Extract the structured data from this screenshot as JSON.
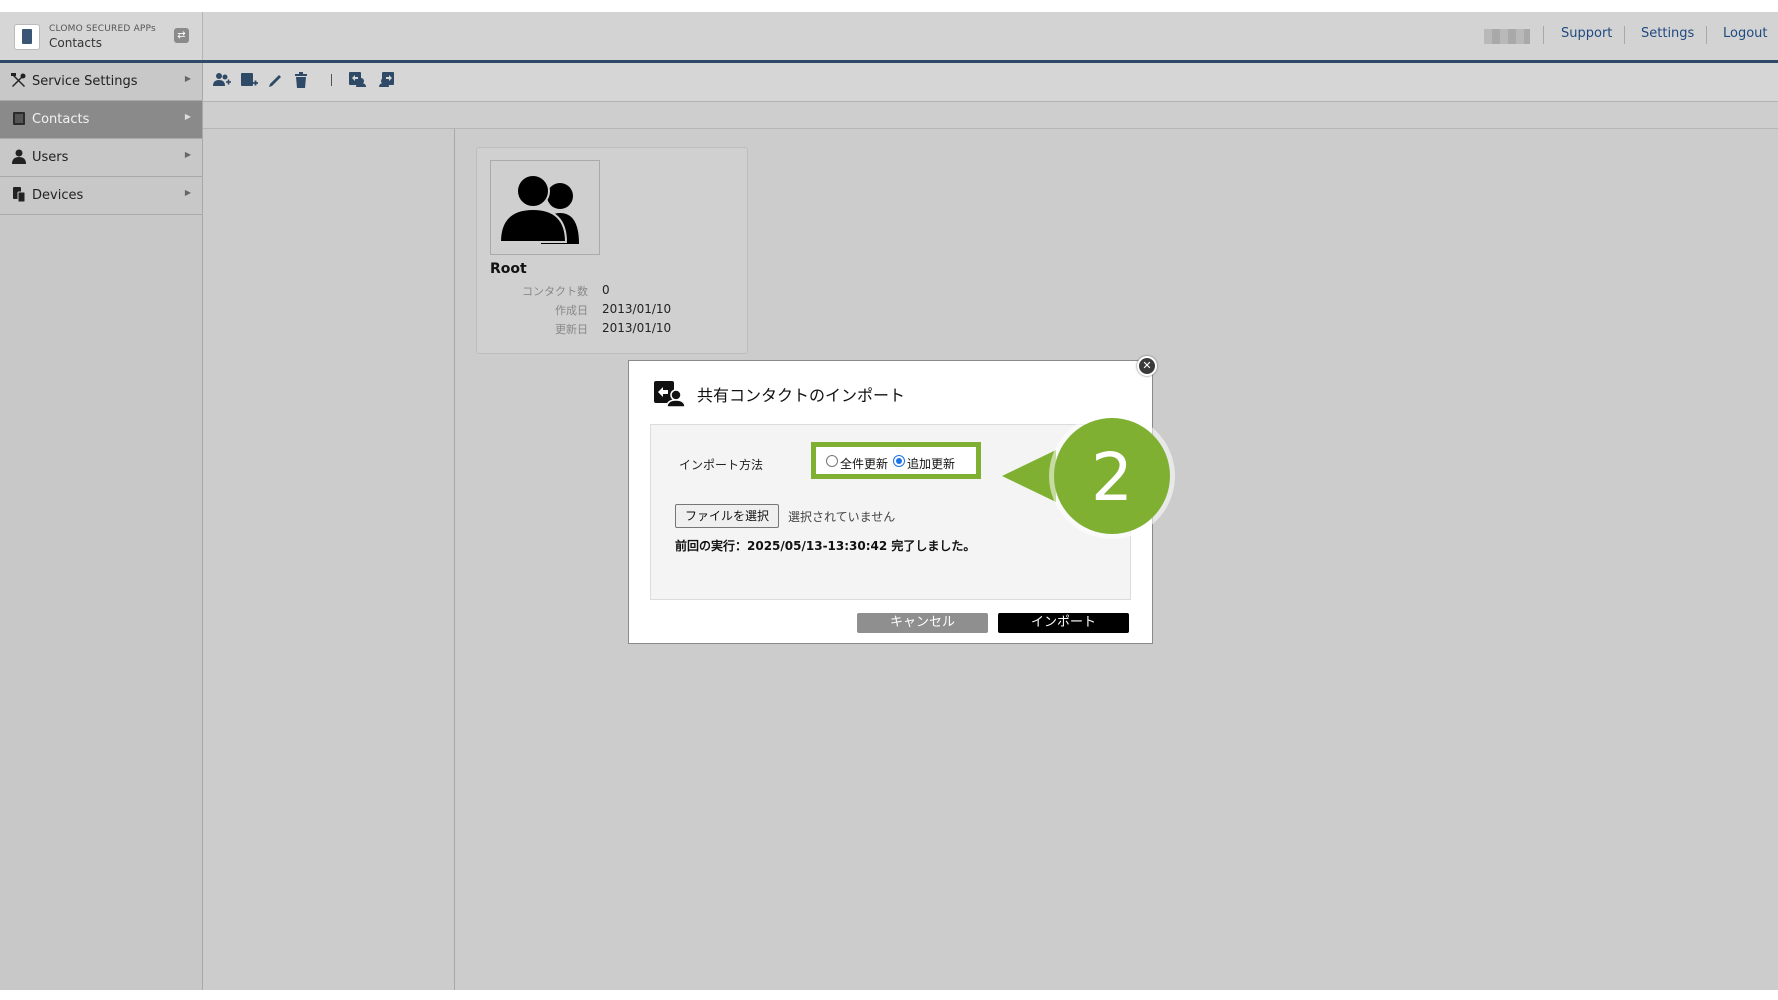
{
  "app": {
    "suite_name": "CLOMO SECURED APPs",
    "title": "Contacts"
  },
  "topnav": {
    "support": "Support",
    "settings": "Settings",
    "logout": "Logout"
  },
  "sidebar": {
    "items": [
      {
        "label": "Service Settings",
        "icon": "tools-icon",
        "active": false
      },
      {
        "label": "Contacts",
        "icon": "contacts-book-icon",
        "active": true
      },
      {
        "label": "Users",
        "icon": "user-icon",
        "active": false
      },
      {
        "label": "Devices",
        "icon": "devices-icon",
        "active": false
      }
    ]
  },
  "toolbar": {
    "icons": [
      "add-contacts-icon",
      "add-group-icon",
      "edit-icon",
      "delete-icon",
      "import-icon",
      "export-icon"
    ]
  },
  "card": {
    "name": "Root",
    "contact_count_label": "コンタクト数",
    "contact_count": "0",
    "created_label": "作成日",
    "created": "2013/01/10",
    "updated_label": "更新日",
    "updated": "2013/01/10"
  },
  "dialog": {
    "title": "共有コンタクトのインポート",
    "method_label": "インポート方法",
    "radio_full": "全件更新",
    "radio_add": "追加更新",
    "selected_method": "追加更新",
    "file_button": "ファイルを選択",
    "file_status": "選択されていません",
    "last_run": "前回の実行：2025/05/13-13:30:42 完了しました。",
    "cancel": "キャンセル",
    "import": "インポート"
  },
  "callout": {
    "step": "2",
    "color": "#7fb032"
  },
  "colors": {
    "header_border": "#2f4a66",
    "link": "#1e4a80",
    "highlight": "#7fb032"
  }
}
